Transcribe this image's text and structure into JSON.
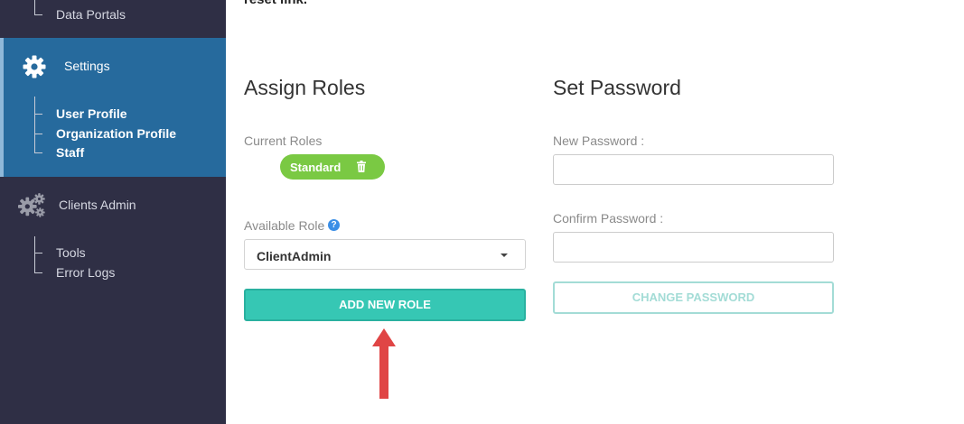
{
  "sidebar": {
    "above_items": [
      {
        "label": "Data Portals"
      }
    ],
    "settings": {
      "label": "Settings",
      "icon": "gear-icon",
      "sub_items": [
        {
          "label": "User Profile"
        },
        {
          "label": "Organization Profile"
        },
        {
          "label": "Staff"
        }
      ]
    },
    "clients_admin": {
      "label": "Clients Admin",
      "icon": "gears-icon",
      "sub_items": [
        {
          "label": "Tools"
        },
        {
          "label": "Error Logs"
        }
      ]
    }
  },
  "main": {
    "top_partial_text": "reset link.",
    "assign_roles": {
      "heading": "Assign Roles",
      "current_roles_label": "Current Roles",
      "current_roles": [
        {
          "label": "Standard",
          "icon": "trash-icon"
        }
      ],
      "available_role_label": "Available Role",
      "available_role_selected": "ClientAdmin",
      "add_button_label": "ADD NEW ROLE"
    },
    "set_password": {
      "heading": "Set Password",
      "new_password_label": "New Password :",
      "new_password_value": "",
      "confirm_password_label": "Confirm Password :",
      "confirm_password_value": "",
      "change_button_label": "CHANGE PASSWORD"
    }
  },
  "colors": {
    "sidebar_bg": "#2f2f45",
    "sidebar_active_bg": "#266a9d",
    "badge_green": "#7ac943",
    "primary_teal": "#36c7b4",
    "disabled_teal": "#a3dcd6",
    "help_blue": "#3a8ee6",
    "annotation_red": "#e04545"
  }
}
